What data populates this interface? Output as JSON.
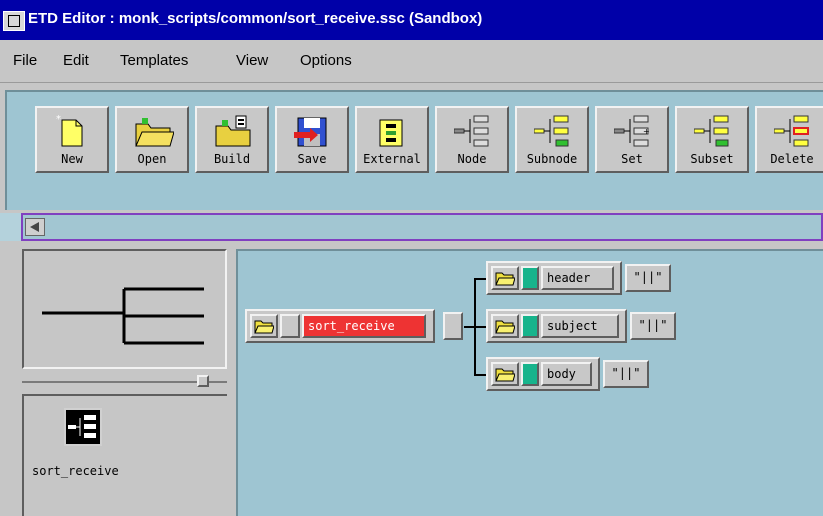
{
  "window": {
    "title": "ETD Editor : monk_scripts/common/sort_receive.ssc (Sandbox)"
  },
  "menu": [
    {
      "label": "File"
    },
    {
      "label": "Edit"
    },
    {
      "label": "Templates"
    },
    {
      "label": "View"
    },
    {
      "label": "Options"
    }
  ],
  "toolbar": {
    "buttons": [
      {
        "label": "New",
        "icon": "new-file-icon"
      },
      {
        "label": "Open",
        "icon": "open-folder-icon"
      },
      {
        "label": "Build",
        "icon": "build-icon"
      },
      {
        "label": "Save",
        "icon": "save-icon"
      },
      {
        "label": "External",
        "icon": "external-icon"
      },
      {
        "label": "Node",
        "icon": "node-icon"
      },
      {
        "label": "Subnode",
        "icon": "subnode-icon"
      },
      {
        "label": "Set",
        "icon": "set-icon"
      },
      {
        "label": "Subset",
        "icon": "subset-icon"
      },
      {
        "label": "Delete",
        "icon": "delete-icon"
      }
    ]
  },
  "explorer": {
    "item_label": "sort_receive"
  },
  "tree": {
    "root": {
      "name": "sort_receive"
    },
    "children": [
      {
        "name": "header",
        "delimiter": "\"||\""
      },
      {
        "name": "subject",
        "delimiter": "\"||\""
      },
      {
        "name": "body",
        "delimiter": "\"||\""
      }
    ]
  },
  "colors": {
    "title_bar": "#0000a8",
    "canvas": "#9ec5d2",
    "selected_node": "#ee3333",
    "node_marker": "#18b48c"
  }
}
